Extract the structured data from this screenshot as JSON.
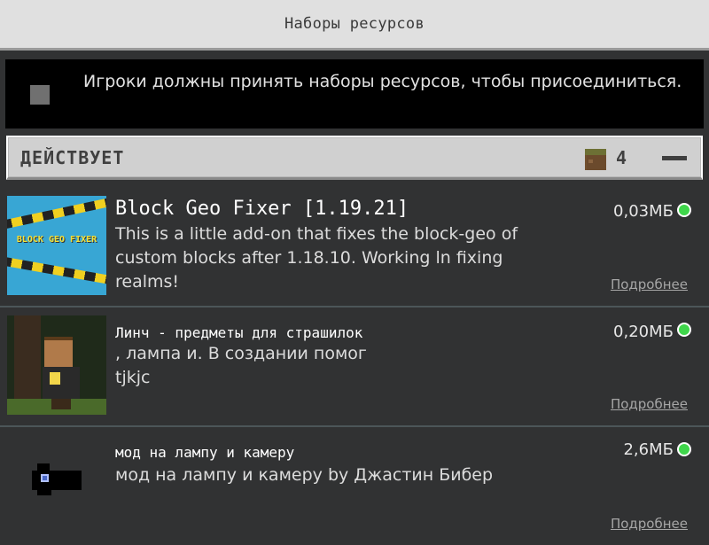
{
  "header": {
    "title": "Наборы ресурсов"
  },
  "notice": {
    "text": "Игроки должны принять наборы ресурсов, чтобы присоединиться."
  },
  "section": {
    "title": "ДЕЙСТВУЕТ",
    "count": "4"
  },
  "packs": [
    {
      "name": "Block Geo Fixer [1.19.21]",
      "description": "This is a little add-on that fixes the block-geo of custom blocks after 1.18.10. Working ln fixing realms!",
      "size": "0,03МБ",
      "thumb_text": "BLOCK GEO FIXER",
      "more": "Подробнее"
    },
    {
      "name": "Линч - предметы для страшилок",
      "description": ", лампа и. В создании помог\n tjkjc",
      "size": "0,20МБ",
      "more": "Подробнее"
    },
    {
      "name": "мод на лампу и камеру",
      "description": "мод на лампу и камеру  by Джастин Бибер",
      "size": "2,6МБ",
      "more": "Подробнее"
    }
  ],
  "colors": {
    "status_active": "#3fd64b",
    "header_bg": "#d0d0d0"
  }
}
